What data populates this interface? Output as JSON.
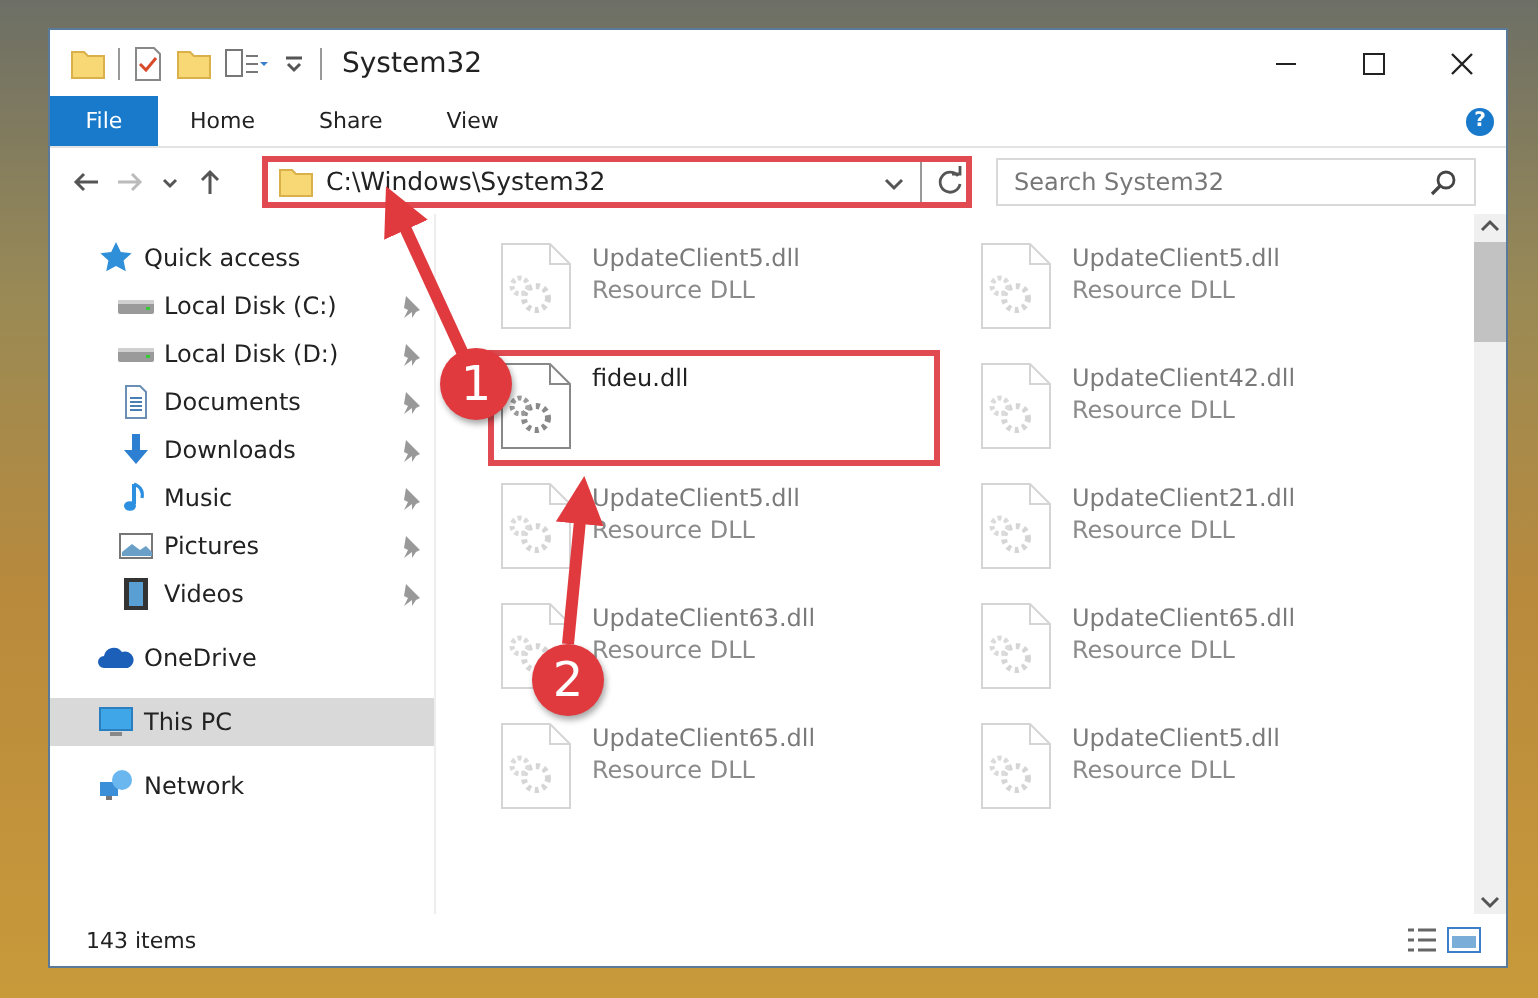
{
  "window": {
    "title": "System32"
  },
  "ribbon": {
    "tabs": [
      {
        "label": "File",
        "kind": "file"
      },
      {
        "label": "Home",
        "kind": "tab"
      },
      {
        "label": "Share",
        "kind": "tab"
      },
      {
        "label": "View",
        "kind": "tab"
      }
    ],
    "help": "?"
  },
  "address": {
    "path": "C:\\Windows\\System32",
    "highlighted": true
  },
  "search": {
    "placeholder": "Search System32"
  },
  "sidebar": {
    "items": [
      {
        "label": "Quick access",
        "kind": "star",
        "selected": false,
        "children": [
          {
            "label": "Local Disk (C:)",
            "kind": "drive",
            "pinned": true
          },
          {
            "label": "Local Disk (D:)",
            "kind": "drive",
            "pinned": true
          },
          {
            "label": "Documents",
            "kind": "document",
            "pinned": true
          },
          {
            "label": "Downloads",
            "kind": "download",
            "pinned": true
          },
          {
            "label": "Music",
            "kind": "music",
            "pinned": true
          },
          {
            "label": "Pictures",
            "kind": "picture",
            "pinned": true
          },
          {
            "label": "Videos",
            "kind": "video",
            "pinned": true
          }
        ]
      },
      {
        "label": "OneDrive",
        "kind": "cloud",
        "selected": false
      },
      {
        "label": "This PC",
        "kind": "computer",
        "selected": true
      },
      {
        "label": "Network",
        "kind": "network",
        "selected": false
      }
    ]
  },
  "files": [
    {
      "name": "UpdateClient5.dll",
      "type": "Resource DLL",
      "blurred": true,
      "highlighted": false
    },
    {
      "name": "UpdateClient5.dll",
      "type": "Resource DLL",
      "blurred": true,
      "highlighted": false
    },
    {
      "name": "fideu.dll",
      "blurred": false,
      "highlighted": true
    },
    {
      "name": "UpdateClient42.dll",
      "type": "Resource DLL",
      "blurred": true,
      "highlighted": false
    },
    {
      "name": "UpdateClient5.dll",
      "type": "Resource DLL",
      "blurred": true,
      "highlighted": false
    },
    {
      "name": "UpdateClient21.dll",
      "type": "Resource DLL",
      "blurred": true,
      "highlighted": false
    },
    {
      "name": "UpdateClient63.dll",
      "type": "Resource DLL",
      "blurred": true,
      "highlighted": false
    },
    {
      "name": "UpdateClient65.dll",
      "type": "Resource DLL",
      "blurred": true,
      "highlighted": false
    },
    {
      "name": "UpdateClient65.dll",
      "type": "Resource DLL",
      "blurred": true,
      "highlighted": false
    },
    {
      "name": "UpdateClient5.dll",
      "type": "Resource DLL",
      "blurred": true,
      "highlighted": false
    }
  ],
  "status_bar": {
    "count": "143 items"
  },
  "callouts": [
    {
      "number": "1"
    },
    {
      "number": "2"
    }
  ]
}
